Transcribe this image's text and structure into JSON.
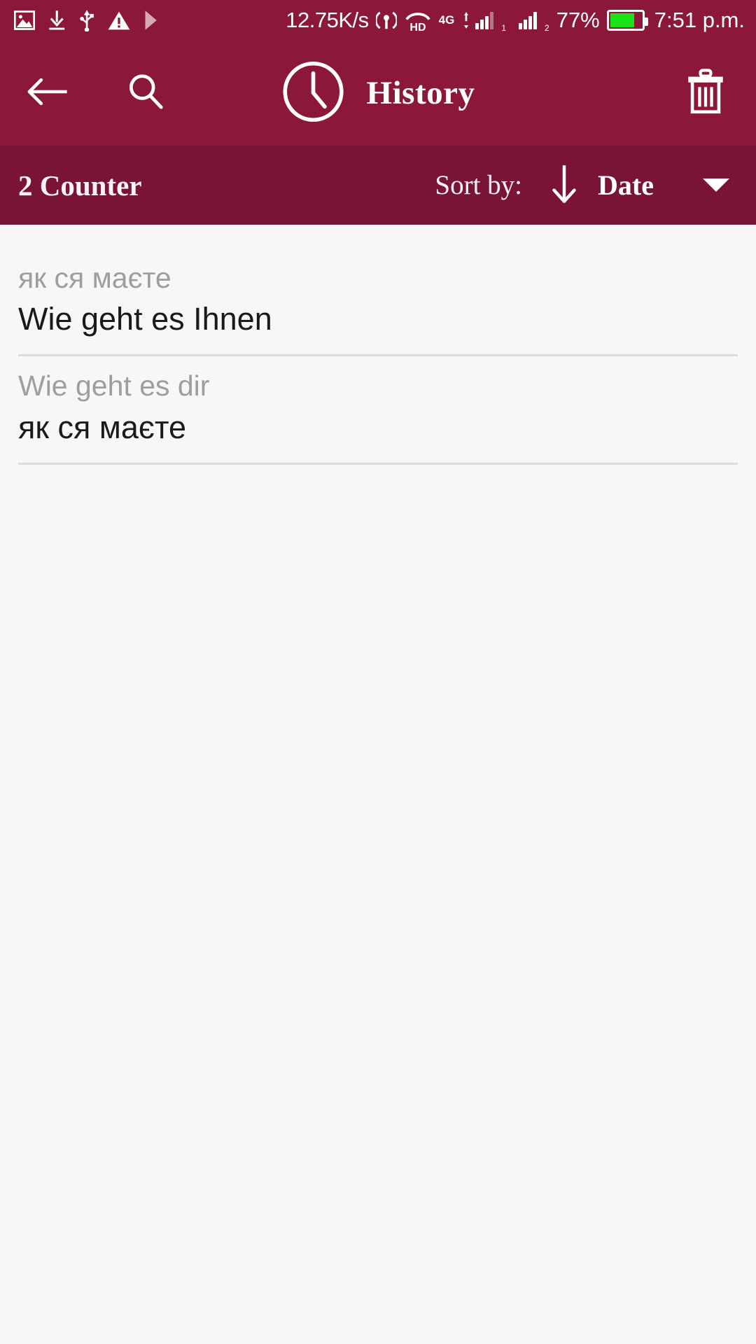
{
  "status_bar": {
    "icons_left": [
      "image-icon",
      "download-icon",
      "usb-icon",
      "warning-icon",
      "play-icon"
    ],
    "network_speed": "12.75K/s",
    "cast_icon": "broadcast-icon",
    "hd_label": "HD",
    "network_type": "4G",
    "sim1_index": "1",
    "sim2_index": "2",
    "battery_percent": "77%",
    "battery_level": 77,
    "time": "7:51 p.m."
  },
  "app_bar": {
    "back_icon": "back-arrow-icon",
    "search_icon": "search-icon",
    "clock_icon": "clock-icon",
    "title": "History",
    "delete_icon": "trash-icon",
    "background_color": "#8c1839"
  },
  "sort_bar": {
    "counter": "2 Counter",
    "sort_label": "Sort by:",
    "direction_icon": "arrow-down-icon",
    "sort_value": "Date",
    "dropdown_icon": "caret-down-icon",
    "background_color": "#7a1435"
  },
  "history": {
    "items": [
      {
        "source": "як ся маєте",
        "target": "Wie geht es Ihnen"
      },
      {
        "source": "Wie geht es dir",
        "target": "як ся маєте"
      }
    ]
  }
}
